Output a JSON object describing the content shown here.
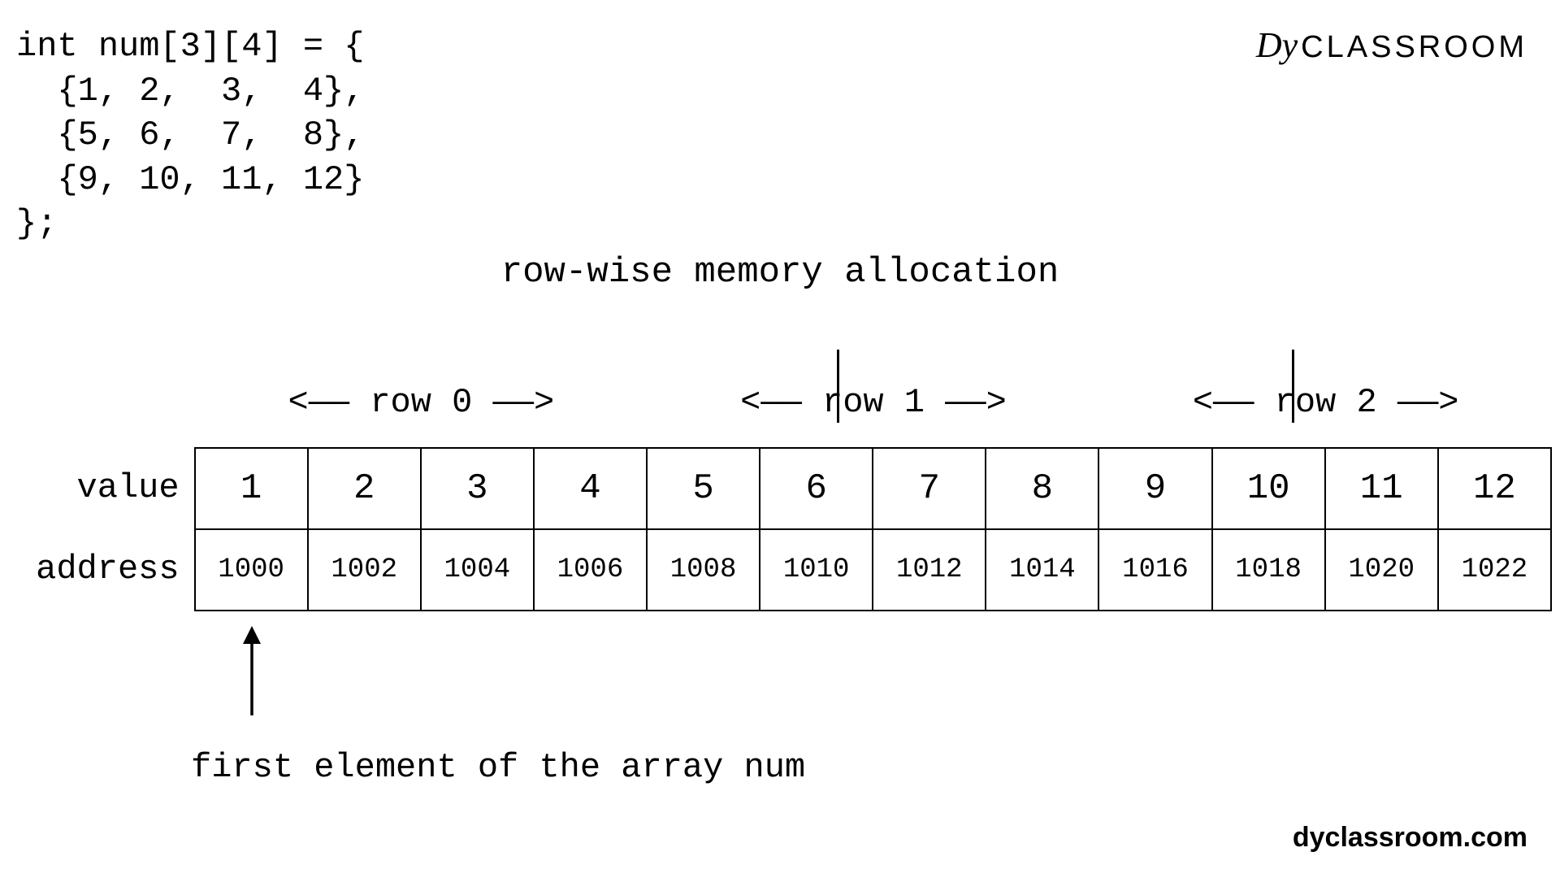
{
  "code": "int num[3][4] = {\n  {1, 2,  3,  4},\n  {5, 6,  7,  8},\n  {9, 10, 11, 12}\n};",
  "logo": {
    "prefix": "Dy",
    "text": "CLASSROOM"
  },
  "title": "row-wise memory allocation",
  "rowHeaders": {
    "r0": "<——  row 0  ——>",
    "r1": "<——  row 1  ——>",
    "r2": "<——  row 2  ——>"
  },
  "sideLabels": {
    "value": "value",
    "address": "address"
  },
  "chart_data": {
    "type": "table",
    "title": "row-wise memory allocation",
    "columns": [
      "value",
      "address"
    ],
    "rows_group_size": 4,
    "row_groups": [
      "row 0",
      "row 1",
      "row 2"
    ],
    "values": [
      1,
      2,
      3,
      4,
      5,
      6,
      7,
      8,
      9,
      10,
      11,
      12
    ],
    "addresses": [
      1000,
      1002,
      1004,
      1006,
      1008,
      1010,
      1012,
      1014,
      1016,
      1018,
      1020,
      1022
    ]
  },
  "caption": "first element of the array num",
  "footer": "dyclassroom.com"
}
